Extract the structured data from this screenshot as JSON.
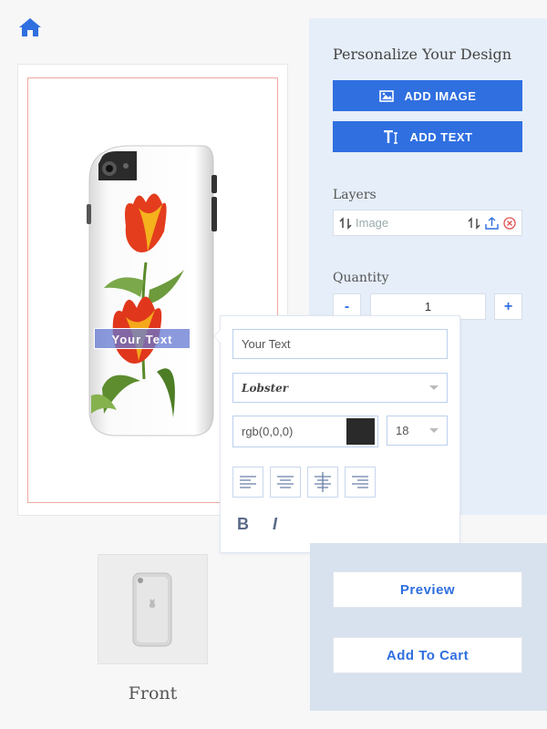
{
  "colors": {
    "accent": "#2f6fe0",
    "panel_bg": "#e6eef9",
    "bottom_panel_bg": "#d8e2ee",
    "print_area_border": "#f0a8a0",
    "text_color_swatch": "#2a2a2a"
  },
  "nav": {
    "home_icon": "home-icon"
  },
  "canvas": {
    "text_layer": "Your Text"
  },
  "panel": {
    "title": "Personalize Your Design",
    "add_image": {
      "label": "ADD IMAGE",
      "icon": "image-icon"
    },
    "add_text": {
      "label": "ADD TEXT",
      "icon": "text-icon"
    },
    "layers": {
      "label": "Layers",
      "items": [
        {
          "label": "Image",
          "icons": [
            "reorder-icon",
            "swap-icon",
            "upload-icon",
            "delete-icon"
          ]
        }
      ]
    },
    "quantity": {
      "label": "Quantity",
      "value": "1",
      "minus": "-",
      "plus": "+"
    }
  },
  "text_editor": {
    "text_value": "Your Text",
    "font": "Lobster",
    "color_value": "rgb(0,0,0)",
    "font_size": "18",
    "align_icons": [
      "align-left-icon",
      "align-center-icon",
      "align-vertical-center-icon",
      "align-right-icon"
    ],
    "bold": "B",
    "italic": "I"
  },
  "views": [
    {
      "label": "Front"
    }
  ],
  "actions": {
    "preview": "Preview",
    "add_to_cart": "Add To Cart"
  }
}
